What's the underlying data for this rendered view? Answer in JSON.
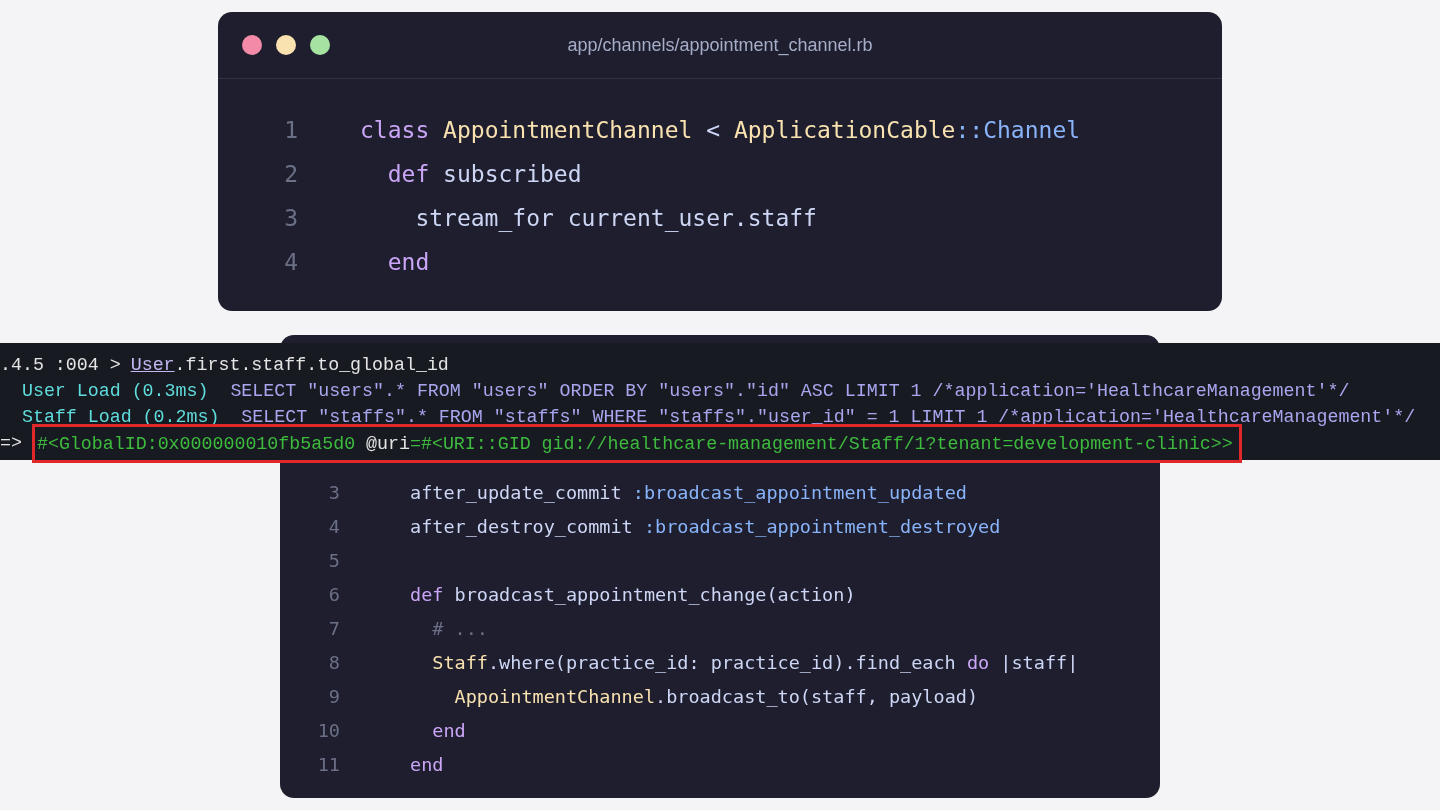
{
  "editor_top": {
    "title": "app/channels/appointment_channel.rb",
    "lines": [
      {
        "number": "1",
        "tokens": [
          {
            "text": "class ",
            "kind": "keyword"
          },
          {
            "text": "AppointmentChannel",
            "kind": "class"
          },
          {
            "text": " < ",
            "kind": "plain"
          },
          {
            "text": "ApplicationCable",
            "kind": "class"
          },
          {
            "text": "::Channel",
            "kind": "symbol"
          }
        ]
      },
      {
        "number": "2",
        "tokens": [
          {
            "text": "  def",
            "kind": "keyword"
          },
          {
            "text": " subscribed",
            "kind": "plain"
          }
        ]
      },
      {
        "number": "3",
        "tokens": [
          {
            "text": "    stream_for current_user.staff",
            "kind": "plain"
          }
        ]
      },
      {
        "number": "4",
        "tokens": [
          {
            "text": "  end",
            "kind": "keyword"
          }
        ]
      }
    ]
  },
  "terminal": {
    "lines": [
      {
        "prompt": ".4.5 :004 >",
        "highlighted": false,
        "tokens": [
          {
            "text": "User",
            "kind": "link"
          },
          {
            "text": ".first.staff.to_global_id",
            "kind": "plain"
          }
        ]
      },
      {
        "highlighted": false,
        "tokens": [
          {
            "text": "  User Load (0.3ms)",
            "kind": "label"
          },
          {
            "text": "  SELECT \"users\".* FROM \"users\" ORDER BY \"users\".\"id\" ASC LIMIT 1 /*application='HealthcareManagement'*/",
            "kind": "sql"
          }
        ]
      },
      {
        "highlighted": false,
        "tokens": [
          {
            "text": "  Staff Load (0.2ms)",
            "kind": "label"
          },
          {
            "text": "  SELECT \"staffs\".* FROM \"staffs\" WHERE \"staffs\".\"user_id\" = 1 LIMIT 1 /*application='HealthcareManagement'*/",
            "kind": "sql"
          }
        ]
      },
      {
        "prompt": "=>",
        "highlighted": true,
        "tokens": [
          {
            "text": "#<GlobalID:0x000000010fb5a5d0 ",
            "kind": "result"
          },
          {
            "text": "@uri",
            "kind": "plain"
          },
          {
            "text": "=#<URI::GID gid://healthcare-management/Staff/1?tenant=development-clinic>>",
            "kind": "result"
          }
        ]
      }
    ]
  },
  "editor_bottom": {
    "lines": [
      {
        "number": "3",
        "tokens": [
          {
            "text": "after_update_commit ",
            "kind": "plain"
          },
          {
            "text": ":broadcast_appointment_updated",
            "kind": "symbol"
          }
        ]
      },
      {
        "number": "4",
        "tokens": [
          {
            "text": "after_destroy_commit ",
            "kind": "plain"
          },
          {
            "text": ":broadcast_appointment_destroyed",
            "kind": "symbol"
          }
        ]
      },
      {
        "number": "5"
      },
      {
        "number": "6",
        "tokens": [
          {
            "text": "def",
            "kind": "keyword"
          },
          {
            "text": " broadcast_appointment_change(action)",
            "kind": "plain"
          }
        ]
      },
      {
        "number": "7",
        "tokens": [
          {
            "text": "  # ...",
            "kind": "comment"
          }
        ]
      },
      {
        "number": "8",
        "tokens": [
          {
            "text": "  Staff",
            "kind": "class"
          },
          {
            "text": ".where(practice_id: practice_id).find_each ",
            "kind": "plain"
          },
          {
            "text": "do",
            "kind": "keyword"
          },
          {
            "text": " |staff|",
            "kind": "plain"
          }
        ]
      },
      {
        "number": "9",
        "tokens": [
          {
            "text": "    AppointmentChannel",
            "kind": "class"
          },
          {
            "text": ".broadcast_to(staff, payload)",
            "kind": "plain"
          }
        ]
      },
      {
        "number": "10",
        "tokens": [
          {
            "text": "  end",
            "kind": "keyword"
          }
        ]
      },
      {
        "number": "11",
        "tokens": [
          {
            "text": "end",
            "kind": "keyword"
          }
        ]
      }
    ]
  }
}
